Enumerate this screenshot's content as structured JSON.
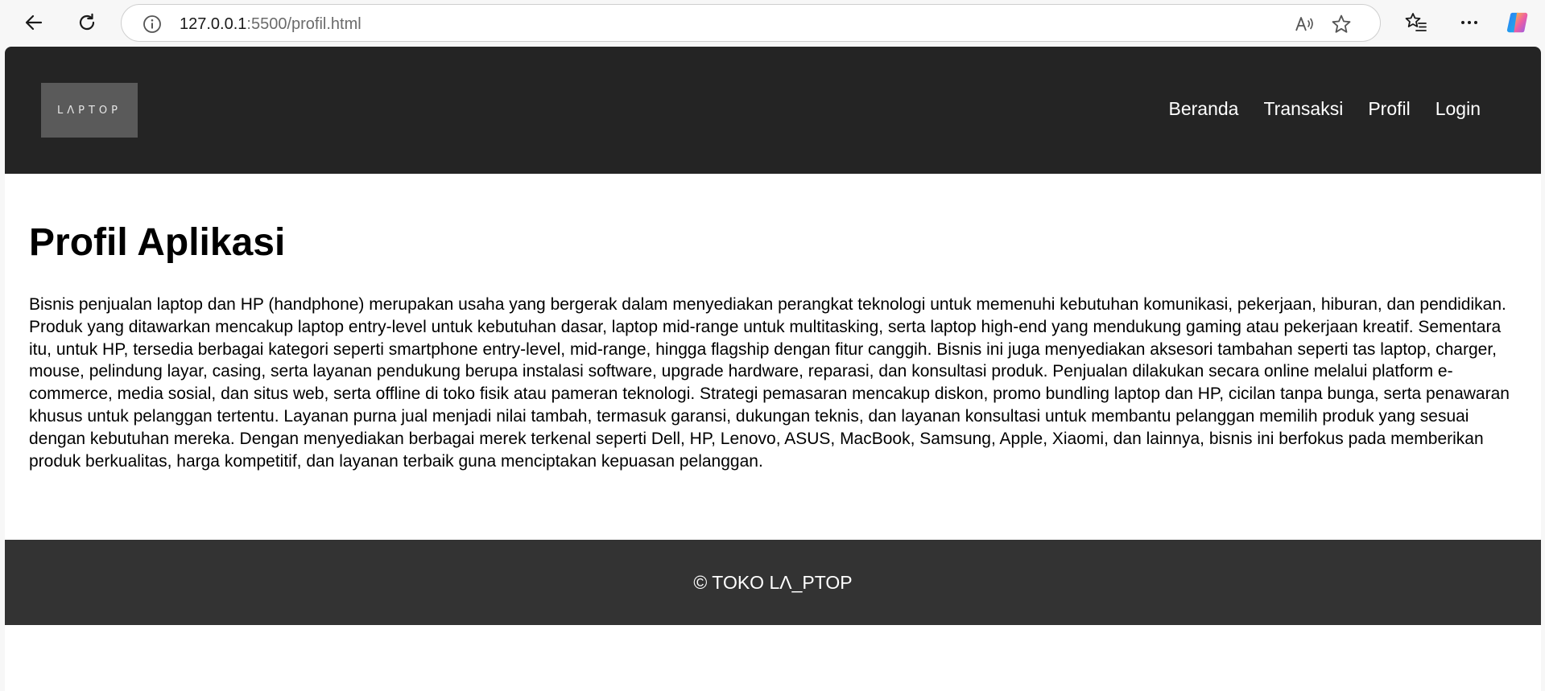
{
  "browser": {
    "host": "127.0.0.1",
    "path": ":5500/profil.html",
    "icons": {
      "back": "arrow-left-icon",
      "reload": "refresh-icon",
      "site_info": "info-icon",
      "read_aloud": "read-aloud-icon",
      "favorite": "star-icon",
      "favorites": "favorites-list-icon",
      "menu": "more-icon",
      "copilot": "copilot-icon"
    }
  },
  "header": {
    "logo_text": "LΛPTOP",
    "nav": [
      "Beranda",
      "Transaksi",
      "Profil",
      "Login"
    ]
  },
  "main": {
    "title": "Profil Aplikasi",
    "body": "Bisnis penjualan laptop dan HP (handphone) merupakan usaha yang bergerak dalam menyediakan perangkat teknologi untuk memenuhi kebutuhan komunikasi, pekerjaan, hiburan, dan pendidikan. Produk yang ditawarkan mencakup laptop entry-level untuk kebutuhan dasar, laptop mid-range untuk multitasking, serta laptop high-end yang mendukung gaming atau pekerjaan kreatif. Sementara itu, untuk HP, tersedia berbagai kategori seperti smartphone entry-level, mid-range, hingga flagship dengan fitur canggih. Bisnis ini juga menyediakan aksesori tambahan seperti tas laptop, charger, mouse, pelindung layar, casing, serta layanan pendukung berupa instalasi software, upgrade hardware, reparasi, dan konsultasi produk. Penjualan dilakukan secara online melalui platform e-commerce, media sosial, dan situs web, serta offline di toko fisik atau pameran teknologi. Strategi pemasaran mencakup diskon, promo bundling laptop dan HP, cicilan tanpa bunga, serta penawaran khusus untuk pelanggan tertentu. Layanan purna jual menjadi nilai tambah, termasuk garansi, dukungan teknis, dan layanan konsultasi untuk membantu pelanggan memilih produk yang sesuai dengan kebutuhan mereka. Dengan menyediakan berbagai merek terkenal seperti Dell, HP, Lenovo, ASUS, MacBook, Samsung, Apple, Xiaomi, dan lainnya, bisnis ini berfokus pada memberikan produk berkualitas, harga kompetitif, dan layanan terbaik guna menciptakan kepuasan pelanggan."
  },
  "footer": {
    "text": "© TOKO LΛ_PTOP"
  },
  "colors": {
    "header_bg": "#242424",
    "footer_bg": "#333333",
    "logo_bg": "#5a5a5a",
    "page_bg": "#ffffff",
    "chrome_bg": "#f7f7f7"
  }
}
